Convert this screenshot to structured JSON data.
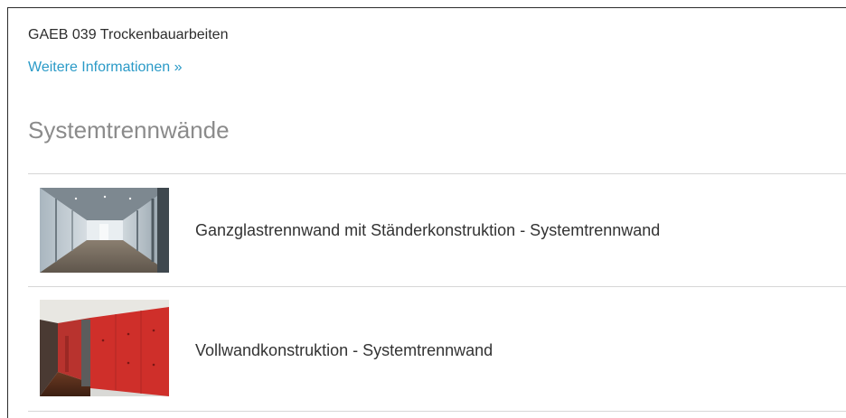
{
  "header": {
    "title": "GAEB 039 Trockenbauarbeiten",
    "more_link": "Weitere Informationen »"
  },
  "section": {
    "title": "Systemtrennwände"
  },
  "items": [
    {
      "label": "Ganzglastrennwand mit Ständerkonstruktion - Systemtrennwand",
      "thumbnail": "glass-partition-corridor-photo"
    },
    {
      "label": "Vollwandkonstruktion - Systemtrennwand",
      "thumbnail": "red-wall-corridor-photo"
    }
  ],
  "colors": {
    "link": "#2a9ac7",
    "section_title": "#8b8b8b",
    "text": "#333333",
    "divider": "#d6d6d6"
  }
}
